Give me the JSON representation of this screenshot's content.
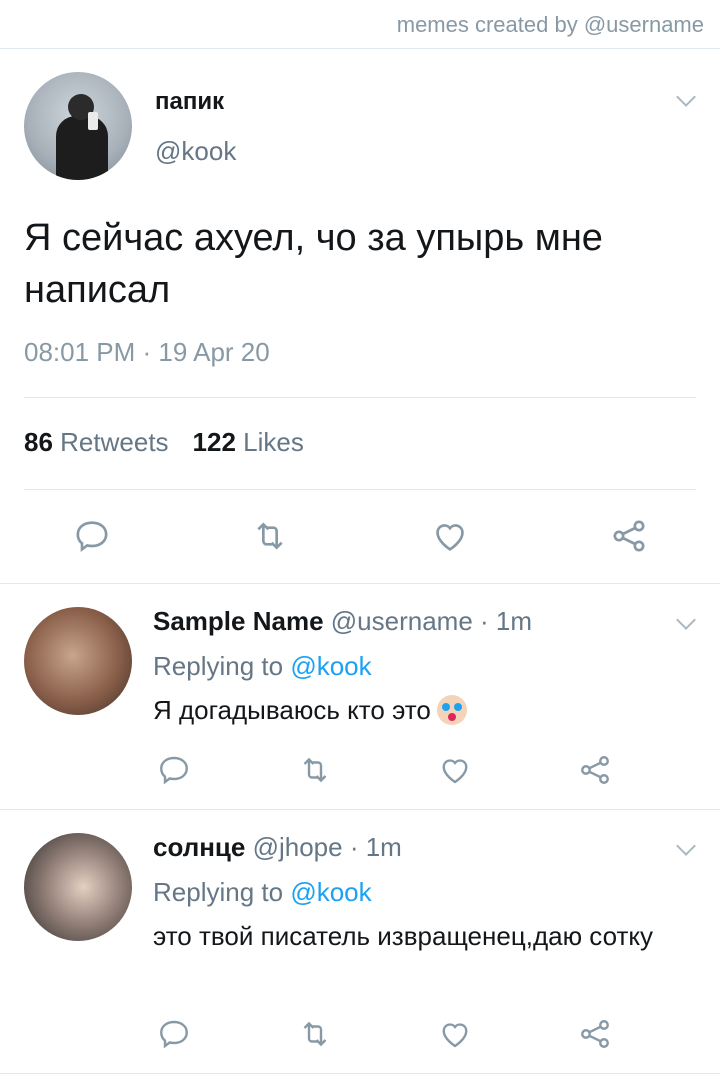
{
  "watermark": "memes created by @username",
  "main_tweet": {
    "name": "папик",
    "handle": "@kook",
    "text": "Я сейчас ахуел, чо за упырь мне написал",
    "timestamp": "08:01 PM · 19 Apr 20",
    "retweets_count": "86",
    "retweets_label": "Retweets",
    "likes_count": "122",
    "likes_label": "Likes"
  },
  "replies": [
    {
      "name": "Sample Name",
      "meta": "@username · 1m",
      "replying_prefix": "Replying to",
      "replying_mention": "@kook",
      "text": "Я догадываюсь кто это"
    },
    {
      "name": "солнце",
      "meta": "@jhope · 1m",
      "replying_prefix": "Replying to",
      "replying_mention": "@kook",
      "text": "это твой писатель извращенец,даю сотку"
    }
  ],
  "icons": [
    "chevron-down-icon",
    "reply-icon",
    "retweet-icon",
    "like-icon",
    "share-icon",
    "clown-face-emoji"
  ],
  "colors": {
    "text": "#14171a",
    "muted": "#657786",
    "link": "#1da1f2",
    "icon": "#8899a6",
    "divider": "#e1e8ed"
  }
}
